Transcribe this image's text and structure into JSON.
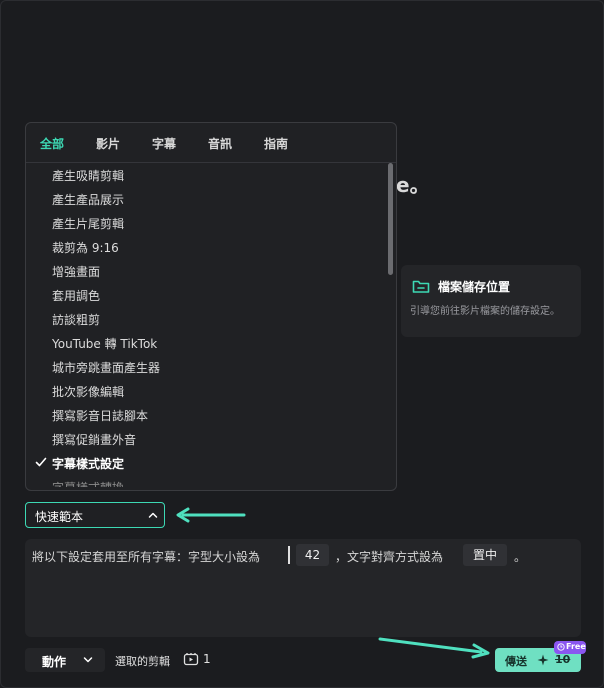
{
  "background": {
    "heading_fragment": "e。",
    "storage_card": {
      "title": "檔案儲存位置",
      "description": "引導您前往影片檔案的儲存設定。",
      "icon": "folder-icon"
    }
  },
  "dropdown": {
    "tabs": [
      {
        "label": "全部",
        "active": true
      },
      {
        "label": "影片",
        "active": false
      },
      {
        "label": "字幕",
        "active": false
      },
      {
        "label": "音訊",
        "active": false
      },
      {
        "label": "指南",
        "active": false
      }
    ],
    "items": [
      {
        "label": "產生吸睛剪輯"
      },
      {
        "label": "產生產品展示"
      },
      {
        "label": "產生片尾剪輯"
      },
      {
        "label": "裁剪為 9:16"
      },
      {
        "label": "增強畫面"
      },
      {
        "label": "套用調色"
      },
      {
        "label": "訪談粗剪"
      },
      {
        "label": "YouTube 轉 TikTok"
      },
      {
        "label": "城市旁跳畫面產生器"
      },
      {
        "label": "批次影像編輯"
      },
      {
        "label": "撰寫影音日誌腳本"
      },
      {
        "label": "撰寫促銷畫外音"
      },
      {
        "label": "字幕樣式設定",
        "selected": true
      }
    ]
  },
  "template_select": {
    "label": "快速範本"
  },
  "prompt": {
    "text_before": "將以下設定套用至所有字幕：字型大小設為",
    "font_size_value": "42",
    "text_middle": "，文字對齊方式設為",
    "alignment_value": "置中",
    "text_end": "。"
  },
  "footer": {
    "action_label": "動作",
    "selected_clips_label": "選取的剪輯",
    "selected_clips_count": "1",
    "send_label": "傳送",
    "credits": "10",
    "free_badge": "Free"
  },
  "colors": {
    "accent": "#3dd9b4",
    "send_button": "#6fe0c2",
    "free_badge": "#8a56f0"
  }
}
